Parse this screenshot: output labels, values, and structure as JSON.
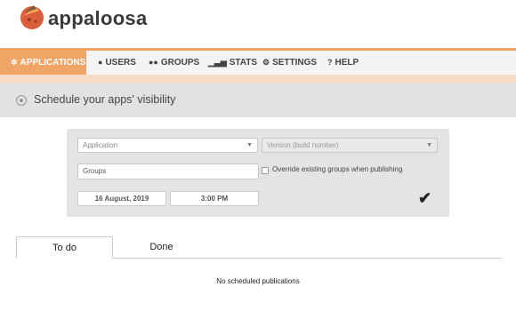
{
  "header": {
    "brand": "appaloosa",
    "logo_icon": "appaloosa-logo-icon"
  },
  "nav": {
    "items": [
      {
        "label": "APPLICATIONS",
        "icon": "apps-icon",
        "active": true
      },
      {
        "label": "USERS",
        "icon": "user-icon",
        "active": false
      },
      {
        "label": "GROUPS",
        "icon": "groups-icon",
        "active": false
      },
      {
        "label": "STATS",
        "icon": "stats-icon",
        "active": false
      },
      {
        "label": "SETTINGS",
        "icon": "gear-icon",
        "active": false
      },
      {
        "label": "HELP",
        "icon": "help-icon",
        "active": false
      }
    ]
  },
  "page": {
    "title": "Schedule your apps' visibility"
  },
  "form": {
    "application_select": "Application",
    "version_select": "Version (build number)",
    "groups_value": "Groups",
    "override_label": "Override existing groups when publishing",
    "override_checked": false,
    "date": "16 August, 2019",
    "time": "3:00 PM"
  },
  "tabs": [
    {
      "label": "To do",
      "active": true
    },
    {
      "label": "Done",
      "active": false
    }
  ],
  "empty_message": "No scheduled publications",
  "colors": {
    "accent": "#f0a566",
    "accent_light": "#f6dcc6",
    "title_bar": "#e2e2e2",
    "panel": "#e4e4e4"
  }
}
